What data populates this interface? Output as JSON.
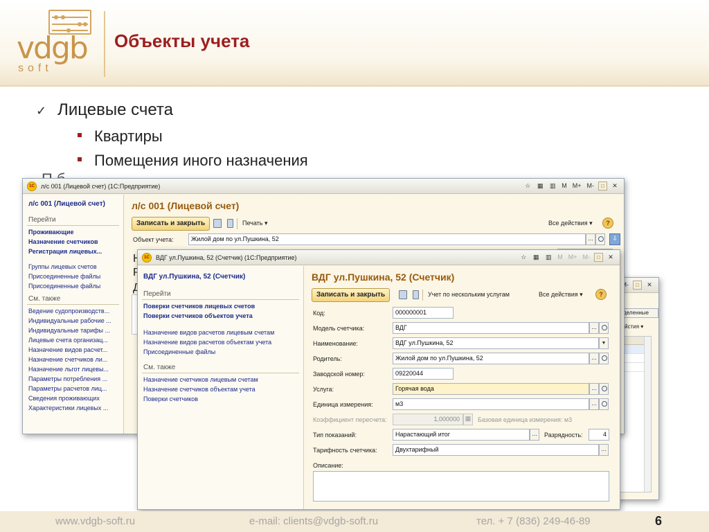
{
  "slide": {
    "title": "Объекты учета",
    "logo": {
      "word": "vdgb",
      "soft": "soft"
    },
    "bullets": [
      {
        "text": "Лицевые счета",
        "children": [
          "Квартиры",
          "Помещения иного назначения"
        ]
      }
    ],
    "hidden_bullet_fragment": "П  б",
    "footer": {
      "website": "www.vdgb-soft.ru",
      "email": "e-mail: clients@vdgb-soft.ru",
      "phone": "тел. + 7 (836) 249-46-89",
      "page": "6"
    }
  },
  "windows": {
    "account": {
      "title": "л/с 001 (Лицевой счет)  (1С:Предприятие)",
      "nav_header": "л/с 001 (Лицевой счет)",
      "nav_sections": [
        "Перейти",
        "См. также"
      ],
      "goto_links": [
        "Проживающие",
        "Назначение счетчиков",
        "Регистрация лицевых..."
      ],
      "other_links": [
        "Группы лицевых счетов",
        "Присоединенные файлы",
        "Присоединенные файлы"
      ],
      "see_also_links": [
        "Ведение судопроизводств...",
        "Индивидуальные рабочие ...",
        "Индивидуальные тарифы ...",
        "Лицевые счета организац...",
        "Назначение видов расчет...",
        "Назначение счетчиков ли...",
        "Назначение льгот лицевы...",
        "Параметры потребления ...",
        "Параметры расчетов лиц...",
        "Сведения проживающих",
        "Характеристики лицевых ..."
      ],
      "form_title": "л/с 001 (Лицевой счет)",
      "save_close": "Записать и закрыть",
      "print": "Печать ▾",
      "all_actions": "Все действия ▾",
      "help": "?",
      "object_label": "Объект учета:",
      "object_value": "Жилой дом по ул.Пушкина, 52",
      "cut_labels": [
        "Н",
        "Р",
        "Д"
      ],
      "buttons": {
        "m": "M",
        "mplus": "M+",
        "mminus": "M-",
        "max": "□",
        "close": "✕"
      }
    },
    "back": {
      "fragments": [
        "M-",
        "□",
        "✕",
        "деленные",
        "дейстия ▾"
      ]
    },
    "meter": {
      "title": "ВДГ ул.Пушкина, 52 (Счетчик)  (1С:Предприятие)",
      "nav_header": "ВДГ ул.Пушкина, 52 (Счетчик)",
      "nav_sections": [
        "Перейти",
        "См. также"
      ],
      "goto_links": [
        "Поверки счетчиков лицевых счетов",
        "Поверки счетчиков объектов учета"
      ],
      "other_links": [
        "Назначение видов расчетов лицевым счетам",
        "Назначение видов расчетов объектам учета",
        "Присоединенные файлы"
      ],
      "see_also_links": [
        "Назначение счетчиков лицевым счетам",
        "Назначение счетчиков объектам учета",
        "Поверки счетчиков"
      ],
      "form_title": "ВДГ ул.Пушкина, 52 (Счетчик)",
      "save_close": "Записать и закрыть",
      "multi_service": "Учет по нескольким услугам",
      "all_actions": "Все действия ▾",
      "help": "?",
      "fields": {
        "code": {
          "label": "Код:",
          "value": "000000001"
        },
        "model": {
          "label": "Модель счетчика:",
          "value": "ВДГ"
        },
        "name": {
          "label": "Наименование:",
          "value": "ВДГ ул.Пушкина, 52"
        },
        "parent": {
          "label": "Родитель:",
          "value": "Жилой дом по ул.Пушкина, 52"
        },
        "serial": {
          "label": "Заводской номер:",
          "value": "09220044"
        },
        "service": {
          "label": "Услуга:",
          "value": "Горячая вода"
        },
        "unit": {
          "label": "Единица измерения:",
          "value": "м3"
        },
        "factor": {
          "label": "Коэффициент пересчета:",
          "value": "1,000000",
          "base_unit": "Базовая единица измерения: м3"
        },
        "reading_type": {
          "label": "Тип показаний:",
          "value": "Нарастающий итог"
        },
        "digits": {
          "label": "Разрядность:",
          "value": "4"
        },
        "tariff": {
          "label": "Тарифность счетчика:",
          "value": "Двухтарифный"
        },
        "description": {
          "label": "Описание:",
          "value": ""
        }
      },
      "buttons": {
        "m": "M",
        "mplus": "M+",
        "mminus": "M-",
        "max": "□",
        "close": "✕"
      }
    }
  }
}
